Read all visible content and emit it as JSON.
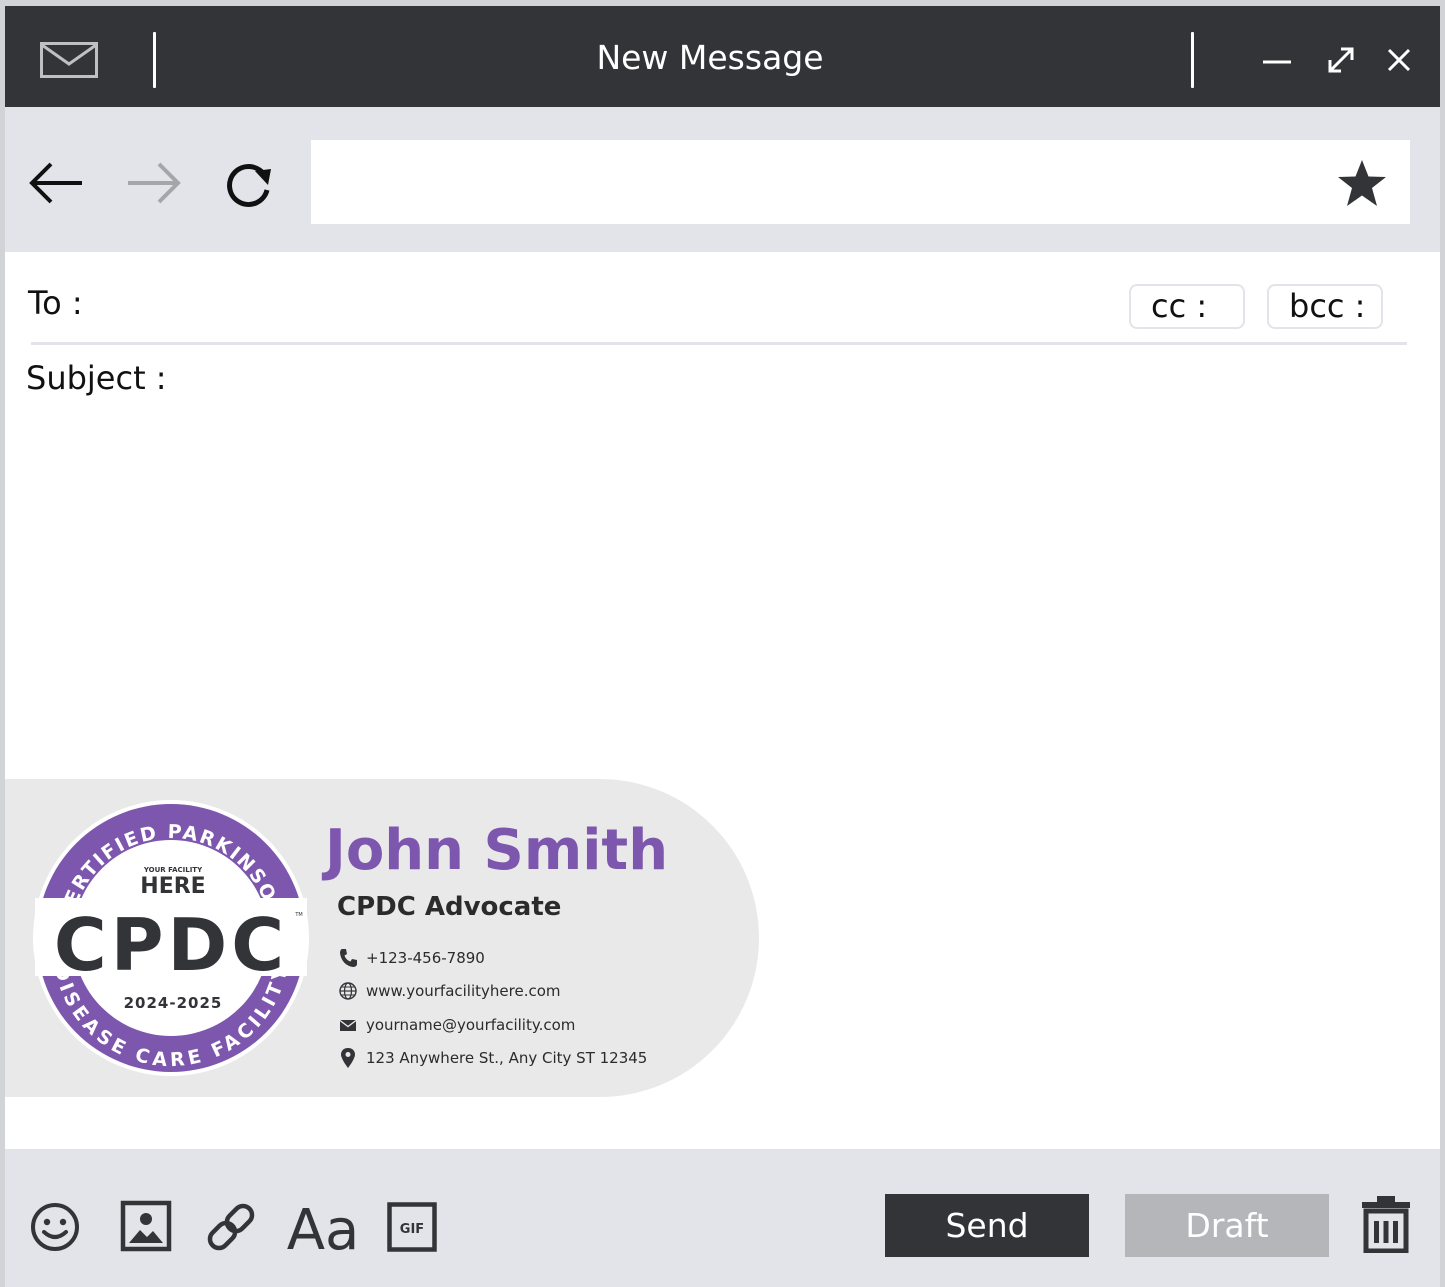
{
  "window": {
    "title": "New Message",
    "icons": [
      "mail-icon",
      "minimize-icon",
      "expand-icon",
      "close-icon"
    ]
  },
  "nav": {
    "icons": [
      "back-arrow-icon",
      "forward-arrow-icon",
      "reload-icon",
      "star-icon"
    ],
    "address_value": ""
  },
  "compose": {
    "to_label": "To :",
    "cc_label": "cc :",
    "bcc_label": "bcc :",
    "subject_label": "Subject :"
  },
  "signature": {
    "name": "John Smith",
    "role": "CPDC Advocate",
    "phone": "+123-456-7890",
    "website": "www.yourfacilityhere.com",
    "email": "yourname@yourfacility.com",
    "address": "123 Anywhere St., Any City ST 12345",
    "seal": {
      "top_arc": "CERTIFIED PARKINSON",
      "facility_small": "YOUR FACILITY",
      "facility_big": "HERE",
      "acronym": "CPDC",
      "tm": "TM",
      "years": "2024-2025",
      "bottom_arc": "DISEASE CARE FACILITY"
    },
    "colors": {
      "accent": "#7d57ad",
      "dark": "#333438"
    }
  },
  "toolbar": {
    "icons": [
      "emoji-icon",
      "image-icon",
      "link-icon",
      "font-icon",
      "gif-icon",
      "trash-icon"
    ],
    "font_label": "Aa",
    "gif_label": "GIF",
    "send_label": "Send",
    "draft_label": "Draft"
  }
}
